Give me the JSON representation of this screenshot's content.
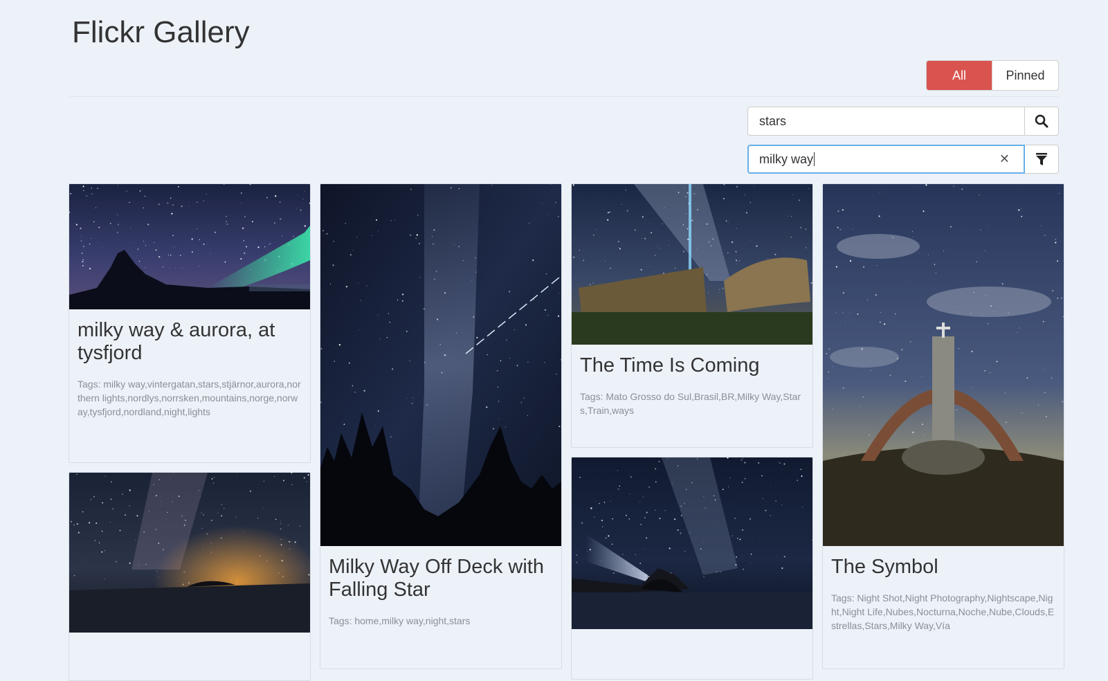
{
  "app": {
    "title": "Flickr Gallery"
  },
  "toggle": {
    "all_label": "All",
    "pinned_label": "Pinned",
    "active": "All"
  },
  "search": {
    "value": "stars"
  },
  "filter": {
    "value": "milky way"
  },
  "colors": {
    "background": "#edf2f9",
    "accent": "#d9534f",
    "focus": "#66afe9"
  },
  "cards": [
    {
      "title": "milky way & aurora, at tysfjord",
      "tags": "Tags: milky way,vintergatan,stars,stjärnor,aurora,northern lights,nordlys,norrsken,mountains,norge,norway,tysfjord,nordland,night,lights"
    },
    {
      "title": "Milky Way Off Deck with Falling Star",
      "tags": "Tags: home,milky way,night,stars"
    },
    {
      "title": "The Time Is Coming",
      "tags": "Tags: Mato Grosso do Sul,Brasil,BR,Milky Way,Stars,Train,ways"
    },
    {
      "title": "The Symbol",
      "tags": "Tags: Night Shot,Night Photography,Nightscape,Night,Night Life,Nubes,Nocturna,Noche,Nube,Clouds,Estrellas,Stars,Milky Way,Vía"
    },
    {
      "title": "",
      "tags": ""
    },
    {
      "title": "",
      "tags": ""
    }
  ]
}
